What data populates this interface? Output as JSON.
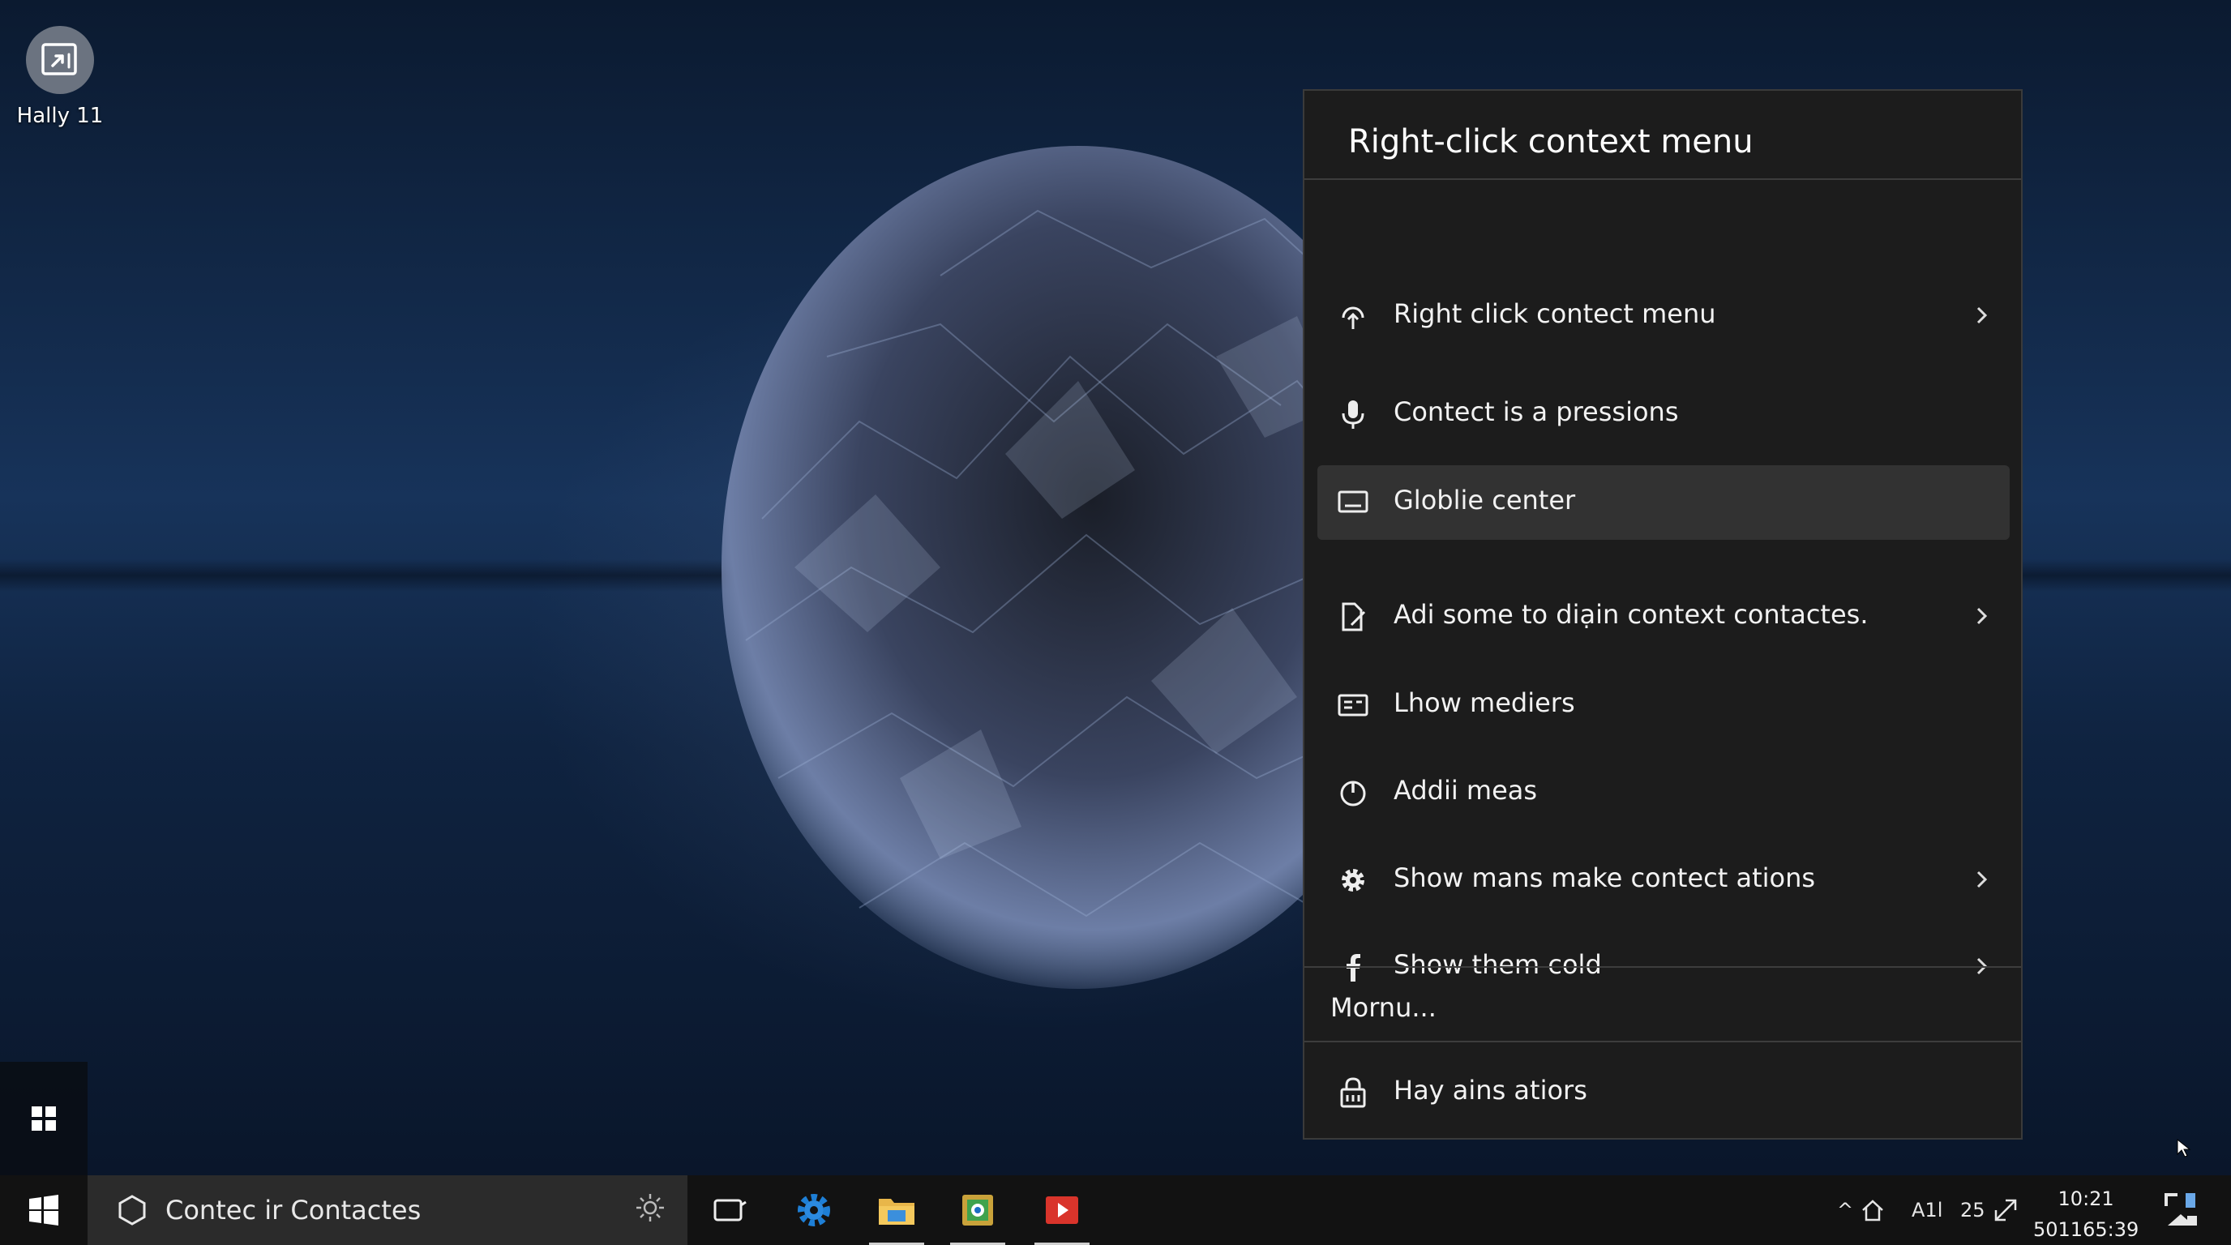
{
  "desktop": {
    "icon_label": "Hally 11"
  },
  "context_menu": {
    "title": "Right-click context menu",
    "items": [
      {
        "label": "Right click contect menu",
        "icon": "upload-icon",
        "submenu": true
      },
      {
        "label": "Contect is a pressions",
        "icon": "microphone-icon",
        "submenu": false
      },
      {
        "label": "Globlie center",
        "icon": "monitor-icon",
        "submenu": false,
        "highlighted": true
      },
      {
        "label": "Adi some to diạin context contactes.",
        "icon": "document-pen-icon",
        "submenu": true
      },
      {
        "label": "Lhow mediers",
        "icon": "media-icon",
        "submenu": false
      },
      {
        "label": "Addii meas",
        "icon": "power-icon",
        "submenu": false
      },
      {
        "label": "Show mans make contect ations",
        "icon": "gear-icon",
        "submenu": true
      },
      {
        "label": "Show them cold",
        "icon": "facebook-icon",
        "submenu": true
      }
    ],
    "more_label": "Mornu...",
    "footer_item": {
      "label": "Hay ains atiors",
      "icon": "lock-icon"
    }
  },
  "taskbar": {
    "search_text": "Contec ir Contactes",
    "apps": [
      "task-view-icon",
      "settings-app-icon",
      "file-explorer-icon",
      "photos-app-icon",
      "media-player-icon"
    ],
    "tray": {
      "chevron": "^",
      "lang": "A1l",
      "num": "25",
      "time": "10:21",
      "date": "501165:39"
    }
  },
  "colors": {
    "menu_bg": "#1c1c1c",
    "menu_highlight": "#323232",
    "taskbar_bg": "#121212",
    "search_bg": "#2b2b2b"
  }
}
